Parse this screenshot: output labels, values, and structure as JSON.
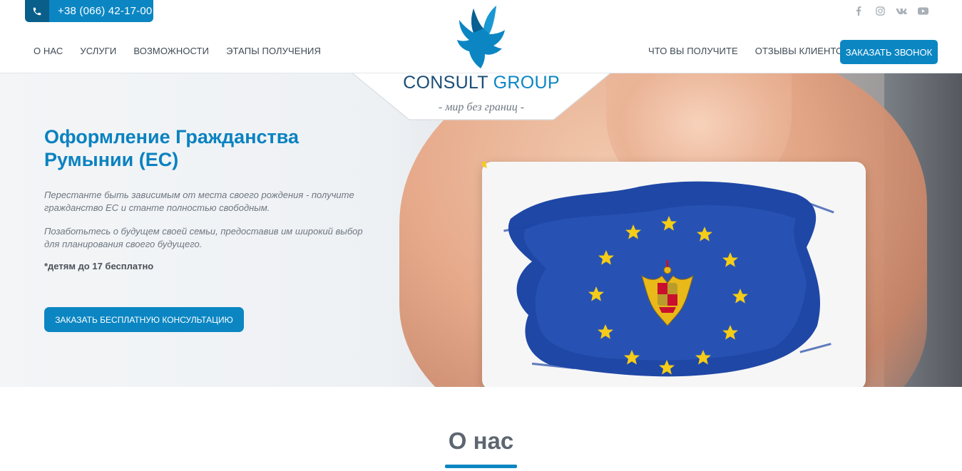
{
  "header": {
    "phone": "+38 (066) 42-17-00",
    "nav_left": [
      {
        "label": "О НАС"
      },
      {
        "label": "УСЛУГИ"
      },
      {
        "label": "ВОЗМОЖНОСТИ"
      },
      {
        "label": "ЭТАПЫ ПОЛУЧЕНИЯ"
      }
    ],
    "nav_right": [
      {
        "label": "ЧТО ВЫ ПОЛУЧИТЕ"
      },
      {
        "label": "ОТЗЫВЫ КЛИЕНТОВ"
      }
    ],
    "cta_label": "ЗАКАЗАТЬ ЗВОНОК",
    "socials": [
      "facebook-icon",
      "instagram-icon",
      "vk-icon",
      "youtube-icon"
    ]
  },
  "logo": {
    "name_part1": "CONSULT",
    "name_part2": "GROUP",
    "tagline": "- мир без границ -"
  },
  "hero": {
    "title": "Оформление Гражданства Румынии (ЕС)",
    "paragraph1": "Перестанте быть зависимым от места своего рождения - получите гражданство ЕС и станте полностью свободным.",
    "paragraph2": "Позаботьтесь о будущем своей семьи, предоставив им широкий выбор для планирования своего будущего.",
    "note": "*детям до 17 бесплатно",
    "cta_label": "ЗАКАЗАТЬ БЕСПЛАТНУЮ КОНСУЛЬТАЦИЮ"
  },
  "about": {
    "title": "О нас"
  },
  "colors": {
    "accent": "#0b86c3",
    "accent_dark": "#0a5e8a",
    "title_blue": "#0a82c0",
    "eu_blue": "#1f47a6",
    "star_yellow": "#f5cc17"
  }
}
